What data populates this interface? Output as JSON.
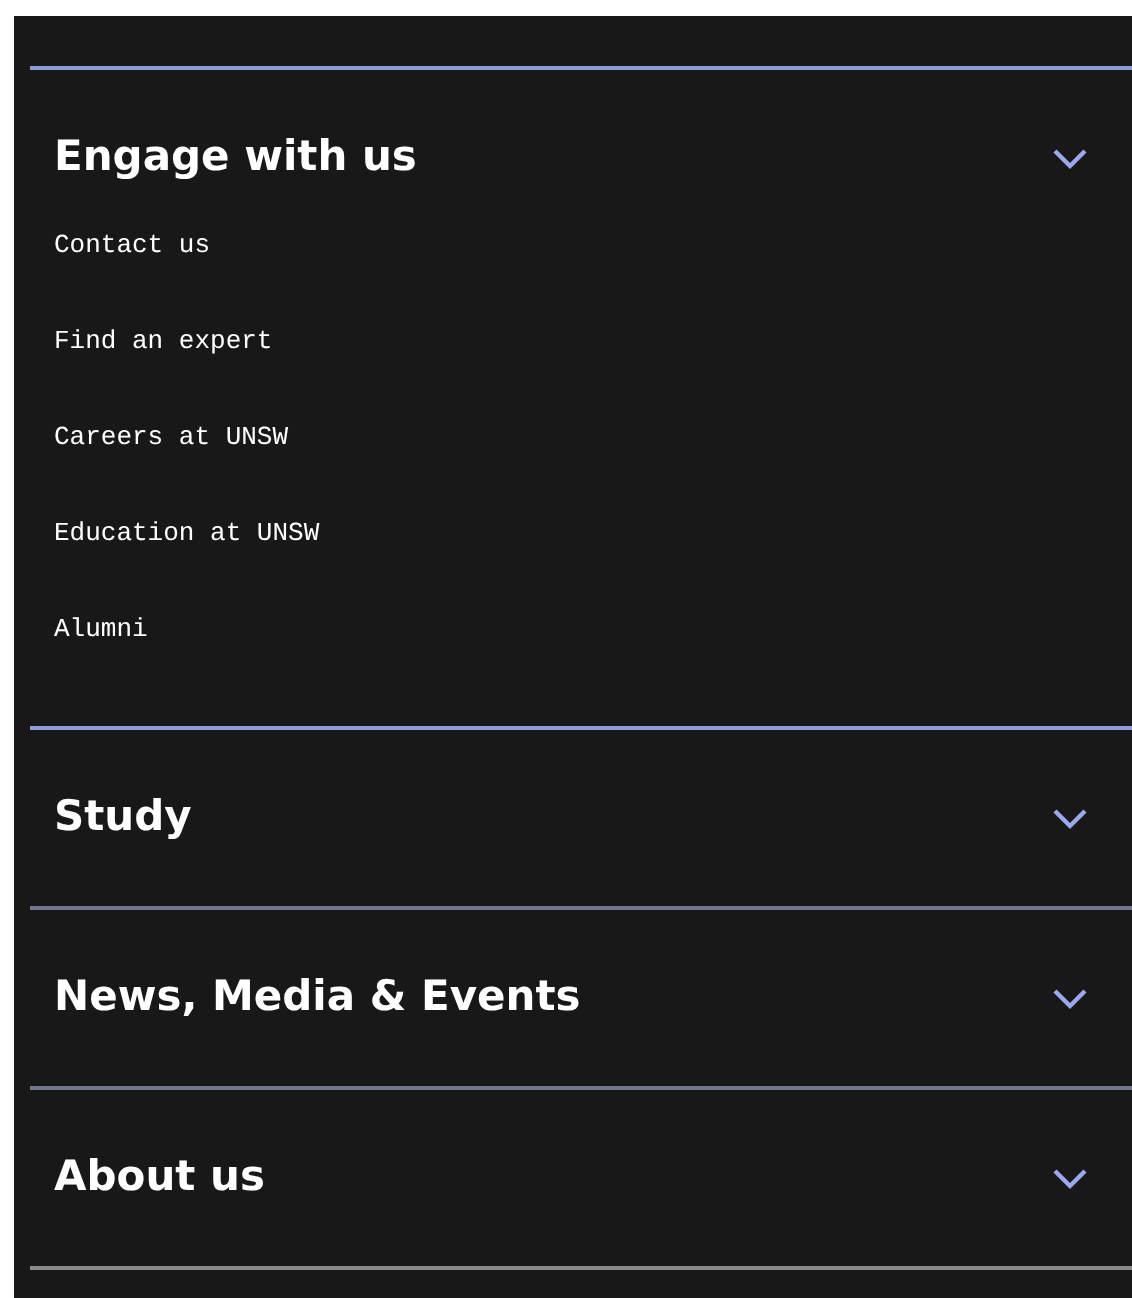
{
  "sections": [
    {
      "title": "Engage with us",
      "expanded": true,
      "links": [
        "Contact us",
        "Find an expert",
        "Careers at UNSW",
        "Education at UNSW",
        "Alumni"
      ]
    },
    {
      "title": "Study",
      "expanded": false
    },
    {
      "title": "News, Media & Events",
      "expanded": false
    },
    {
      "title": "About us",
      "expanded": false
    }
  ]
}
